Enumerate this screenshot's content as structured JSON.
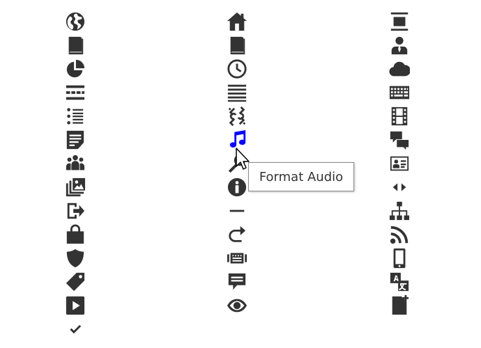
{
  "icon_color": "#333333",
  "hover_color": "#0a0af5",
  "tooltip": {
    "text": "Format Audio"
  },
  "columns": [
    {
      "icons": [
        "globe-icon",
        "book-icon",
        "pie-chart-icon",
        "page-break-icon",
        "list-bullets-icon",
        "note-icon",
        "group-icon",
        "photo-gallery-icon",
        "sign-out-icon",
        "shopping-bag-icon",
        "shield-icon",
        "tag-icon",
        "play-icon",
        "checkmark-icon"
      ]
    },
    {
      "icons": [
        "home-icon",
        "book-icon",
        "clock-icon",
        "justify-icon",
        "unlink-icon",
        "format-audio-icon",
        "search-icon",
        "info-icon",
        "minus-icon",
        "redo-icon",
        "keyboard-icon",
        "comment-icon",
        "eye-icon"
      ]
    },
    {
      "icons": [
        "horizontal-rule-icon",
        "user-icon",
        "cloud-icon",
        "keyboard-grid-icon",
        "film-icon",
        "comments-icon",
        "id-card-icon",
        "code-arrows-icon",
        "sitemap-icon",
        "rss-icon",
        "mobile-icon",
        "translate-icon",
        "new-file-icon"
      ]
    }
  ]
}
